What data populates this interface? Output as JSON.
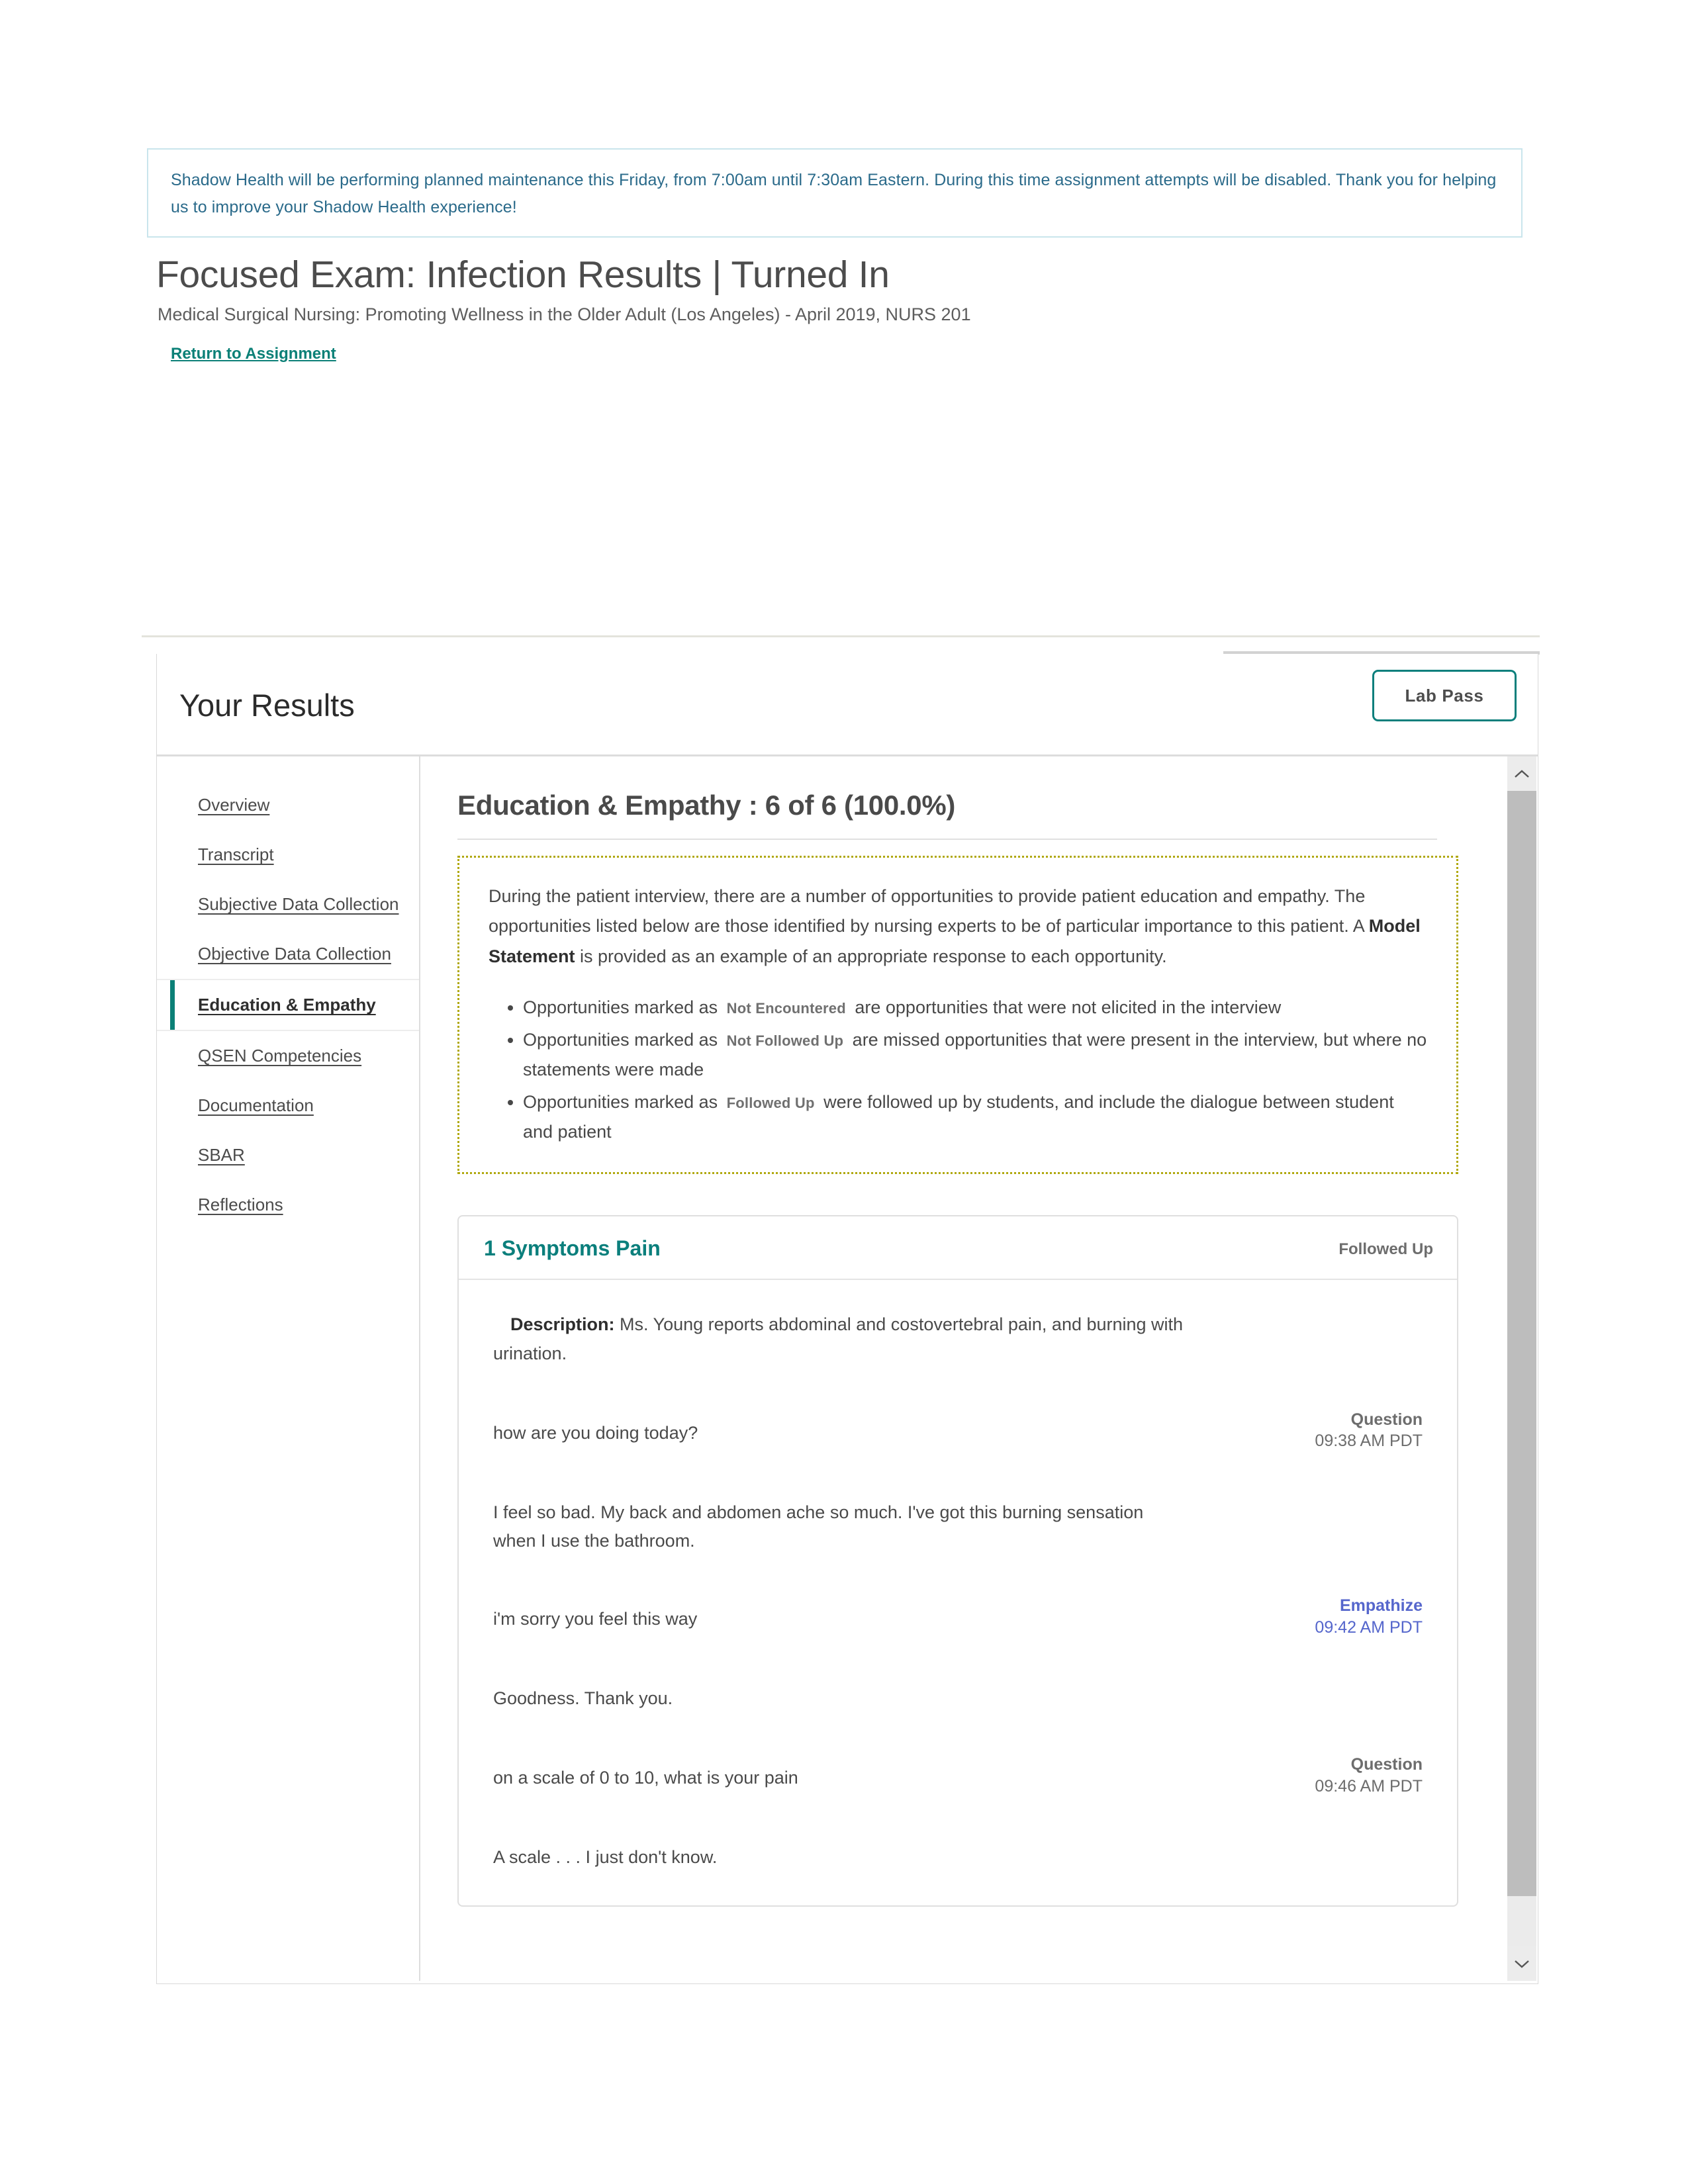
{
  "banner": {
    "text": "Shadow Health will be performing planned maintenance this Friday, from 7:00am until 7:30am Eastern. During this time assignment attempts will be disabled. Thank you for helping us to improve your Shadow Health experience!"
  },
  "header": {
    "title": "Focused Exam: Infection Results | Turned In",
    "subtitle": "Medical Surgical Nursing: Promoting Wellness in the Older Adult (Los Angeles) - April 2019, NURS 201",
    "return_link": "Return to Assignment"
  },
  "results": {
    "title": "Your Results",
    "lab_pass_label": "Lab Pass"
  },
  "sidebar": {
    "items": [
      {
        "label": "Overview",
        "active": false
      },
      {
        "label": "Transcript",
        "active": false
      },
      {
        "label": "Subjective Data Collection",
        "active": false
      },
      {
        "label": "Objective Data Collection",
        "active": false
      },
      {
        "label": "Education & Empathy",
        "active": true
      },
      {
        "label": "QSEN Competencies",
        "active": false
      },
      {
        "label": "Documentation",
        "active": false
      },
      {
        "label": "SBAR",
        "active": false
      },
      {
        "label": "Reflections",
        "active": false
      }
    ]
  },
  "content": {
    "heading": "Education & Empathy : 6 of 6 (100.0%)",
    "score": {
      "earned": 6,
      "total": 6,
      "percent": "100.0%"
    },
    "info": {
      "intro_1": "During the patient interview, there are a number of opportunities to provide patient education and empathy. The opportunities listed below are those identified by nursing experts to be of particular importance to this patient. A ",
      "intro_bold": "Model Statement",
      "intro_2": " is provided as an example of an appropriate response to each opportunity.",
      "bullets": [
        {
          "pre": "Opportunities marked as",
          "badge": "Not Encountered",
          "post": "are opportunities that were not elicited in the interview"
        },
        {
          "pre": "Opportunities marked as",
          "badge": "Not Followed Up",
          "post": "are missed opportunities that were present in the interview, but where no statements were made"
        },
        {
          "pre": "Opportunities marked as",
          "badge": "Followed Up",
          "post": "were followed up by students, and include the dialogue between student and patient"
        }
      ]
    },
    "opportunity": {
      "title": "1 Symptoms Pain",
      "status": "Followed Up",
      "description_label": "Description:",
      "description_text": " Ms. Young reports abdominal and costovertebral pain, and burning with urination.",
      "turns": [
        {
          "text": "how are you doing today?",
          "label": "Question",
          "time": "09:38 AM PDT",
          "kind": "question"
        },
        {
          "text": "I feel so bad. My back and abdomen ache so much. I've got this burning sensation when I use the bathroom.",
          "label": "",
          "time": "",
          "kind": "patient"
        },
        {
          "text": "i'm sorry you feel this way",
          "label": "Empathize",
          "time": "09:42 AM PDT",
          "kind": "empathize"
        },
        {
          "text": "Goodness. Thank you.",
          "label": "",
          "time": "",
          "kind": "patient"
        },
        {
          "text": "on a scale of 0 to 10, what is your pain",
          "label": "Question",
          "time": "09:46 AM PDT",
          "kind": "question"
        },
        {
          "text": "A scale . . . I just don't know.",
          "label": "",
          "time": "",
          "kind": "patient"
        }
      ]
    }
  },
  "scrollbar": {
    "up_label": "⌃",
    "down_label": "⌄"
  },
  "colors": {
    "accent_teal": "#0b8077",
    "banner_blue": "#2a6a8a",
    "empathize_blue": "#5566cc",
    "dotted_border": "#b0a80e"
  }
}
